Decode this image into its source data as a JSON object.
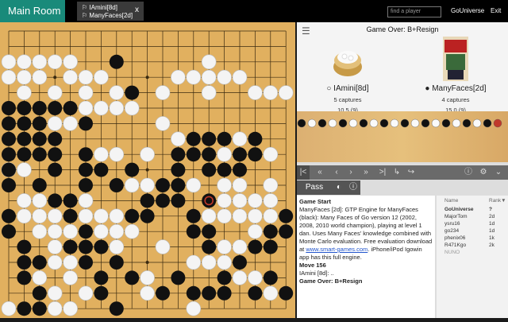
{
  "topbar": {
    "main_room": "Main Room",
    "tab_line1": "IAmini[8d]",
    "tab_line2": "ManyFaces[2d]",
    "tab_close": "x",
    "find_placeholder": "find a player",
    "gouniverse": "GoUniverse",
    "exit": "Exit"
  },
  "game": {
    "title": "Game Over: B+Resign",
    "white": {
      "name": "IAmini[8d]",
      "captures": "5 captures",
      "time": "10.5 (9)"
    },
    "black": {
      "name": "ManyFaces[2d]",
      "captures": "4 captures",
      "time": "15.0 (9)"
    }
  },
  "controls": {
    "pass": "Pass"
  },
  "chat": {
    "start": "Game Start",
    "msg": "ManyFaces [2d]: GTP Engine for ManyFaces (black): Many Faces of Go version 12 (2002, 2008, 2010 world champion), playing at level 1 dan. Uses Many Faces' knowledge combined with Monte Carlo evaluation. Free evaluation download at ",
    "link": "www.smart-games.com",
    "msg2": ". iPhone/iPod Igowin app has this full engine.",
    "move": "Move 156",
    "iamini": "IAmini [8d]: ..",
    "over": "Game Over: B+Resign"
  },
  "users": {
    "h_name": "Name",
    "h_rank": "Rank▼",
    "list": [
      {
        "n": "GoUniverse",
        "r": "?"
      },
      {
        "n": "MajorTom",
        "r": "2d"
      },
      {
        "n": "ysru16",
        "r": "1d"
      },
      {
        "n": "go234",
        "r": "1d"
      },
      {
        "n": "phenix06",
        "r": "1k"
      },
      {
        "n": "R471Kgo",
        "r": "2k"
      },
      {
        "n": "NUNO",
        "r": ""
      }
    ]
  },
  "stones": {
    "black": [
      [
        7,
        2
      ],
      [
        8,
        4
      ],
      [
        0,
        5
      ],
      [
        1,
        5
      ],
      [
        2,
        5
      ],
      [
        3,
        5
      ],
      [
        4,
        5
      ],
      [
        0,
        6
      ],
      [
        1,
        6
      ],
      [
        2,
        6
      ],
      [
        5,
        6
      ],
      [
        0,
        7
      ],
      [
        1,
        7
      ],
      [
        2,
        7
      ],
      [
        3,
        7
      ],
      [
        12,
        7
      ],
      [
        13,
        7
      ],
      [
        14,
        7
      ],
      [
        16,
        7
      ],
      [
        0,
        8
      ],
      [
        1,
        8
      ],
      [
        2,
        8
      ],
      [
        3,
        8
      ],
      [
        5,
        8
      ],
      [
        11,
        8
      ],
      [
        12,
        8
      ],
      [
        13,
        8
      ],
      [
        15,
        8
      ],
      [
        16,
        8
      ],
      [
        0,
        9
      ],
      [
        3,
        9
      ],
      [
        5,
        9
      ],
      [
        6,
        9
      ],
      [
        8,
        9
      ],
      [
        11,
        9
      ],
      [
        13,
        9
      ],
      [
        14,
        9
      ],
      [
        15,
        9
      ],
      [
        0,
        10
      ],
      [
        2,
        10
      ],
      [
        5,
        10
      ],
      [
        7,
        10
      ],
      [
        10,
        10
      ],
      [
        11,
        10
      ],
      [
        3,
        11
      ],
      [
        4,
        11
      ],
      [
        9,
        11
      ],
      [
        10,
        11
      ],
      [
        11,
        11
      ],
      [
        13,
        11
      ],
      [
        0,
        12
      ],
      [
        4,
        12
      ],
      [
        8,
        12
      ],
      [
        9,
        12
      ],
      [
        12,
        12
      ],
      [
        18,
        12
      ],
      [
        0,
        13
      ],
      [
        5,
        13
      ],
      [
        12,
        13
      ],
      [
        13,
        13
      ],
      [
        17,
        13
      ],
      [
        18,
        13
      ],
      [
        1,
        14
      ],
      [
        4,
        14
      ],
      [
        5,
        14
      ],
      [
        6,
        14
      ],
      [
        13,
        14
      ],
      [
        16,
        14
      ],
      [
        17,
        14
      ],
      [
        1,
        15
      ],
      [
        2,
        15
      ],
      [
        5,
        15
      ],
      [
        7,
        15
      ],
      [
        15,
        15
      ],
      [
        1,
        16
      ],
      [
        6,
        16
      ],
      [
        8,
        16
      ],
      [
        11,
        16
      ],
      [
        14,
        16
      ],
      [
        17,
        16
      ],
      [
        2,
        17
      ],
      [
        6,
        17
      ],
      [
        10,
        17
      ],
      [
        12,
        17
      ],
      [
        13,
        17
      ],
      [
        14,
        17
      ],
      [
        16,
        17
      ],
      [
        18,
        17
      ],
      [
        1,
        18
      ],
      [
        2,
        18
      ],
      [
        7,
        18
      ]
    ],
    "white": [
      [
        0,
        2
      ],
      [
        1,
        2
      ],
      [
        2,
        2
      ],
      [
        3,
        2
      ],
      [
        4,
        2
      ],
      [
        13,
        2
      ],
      [
        0,
        3
      ],
      [
        1,
        3
      ],
      [
        2,
        3
      ],
      [
        4,
        3
      ],
      [
        5,
        3
      ],
      [
        6,
        3
      ],
      [
        11,
        3
      ],
      [
        12,
        3
      ],
      [
        13,
        3
      ],
      [
        14,
        3
      ],
      [
        15,
        3
      ],
      [
        1,
        4
      ],
      [
        3,
        4
      ],
      [
        5,
        4
      ],
      [
        7,
        4
      ],
      [
        10,
        4
      ],
      [
        13,
        4
      ],
      [
        16,
        4
      ],
      [
        17,
        4
      ],
      [
        18,
        4
      ],
      [
        3,
        6
      ],
      [
        4,
        6
      ],
      [
        5,
        5
      ],
      [
        6,
        5
      ],
      [
        7,
        5
      ],
      [
        8,
        5
      ],
      [
        10,
        6
      ],
      [
        11,
        7
      ],
      [
        14,
        8
      ],
      [
        17,
        8
      ],
      [
        15,
        7
      ],
      [
        0,
        9
      ],
      [
        1,
        9
      ],
      [
        6,
        8
      ],
      [
        7,
        8
      ],
      [
        9,
        8
      ],
      [
        8,
        10
      ],
      [
        9,
        10
      ],
      [
        12,
        10
      ],
      [
        14,
        10
      ],
      [
        15,
        10
      ],
      [
        17,
        10
      ],
      [
        1,
        11
      ],
      [
        2,
        11
      ],
      [
        5,
        11
      ],
      [
        14,
        11
      ],
      [
        15,
        11
      ],
      [
        16,
        11
      ],
      [
        17,
        11
      ],
      [
        1,
        12
      ],
      [
        2,
        12
      ],
      [
        3,
        12
      ],
      [
        5,
        12
      ],
      [
        6,
        12
      ],
      [
        7,
        12
      ],
      [
        13,
        12
      ],
      [
        14,
        12
      ],
      [
        15,
        12
      ],
      [
        16,
        12
      ],
      [
        17,
        12
      ],
      [
        2,
        13
      ],
      [
        3,
        13
      ],
      [
        4,
        13
      ],
      [
        6,
        13
      ],
      [
        7,
        13
      ],
      [
        8,
        13
      ],
      [
        16,
        13
      ],
      [
        3,
        14
      ],
      [
        7,
        14
      ],
      [
        10,
        14
      ],
      [
        14,
        14
      ],
      [
        15,
        14
      ],
      [
        3,
        15
      ],
      [
        4,
        15
      ],
      [
        12,
        15
      ],
      [
        13,
        15
      ],
      [
        14,
        15
      ],
      [
        2,
        16
      ],
      [
        4,
        16
      ],
      [
        9,
        16
      ],
      [
        15,
        16
      ],
      [
        16,
        16
      ],
      [
        3,
        17
      ],
      [
        5,
        17
      ],
      [
        9,
        17
      ],
      [
        17,
        17
      ],
      [
        0,
        18
      ],
      [
        3,
        18
      ],
      [
        4,
        18
      ],
      [
        12,
        18
      ]
    ],
    "last": [
      13,
      11
    ]
  },
  "colors": {
    "teal": "#198a7a",
    "board": "#e1b05f",
    "red": "#c0392b"
  }
}
